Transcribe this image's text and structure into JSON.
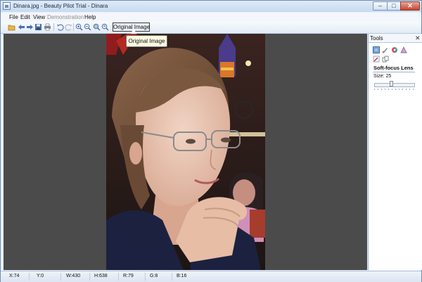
{
  "window": {
    "title": "Dinara.jpg - Beauty Pilot Trial - Dinara",
    "controls": {
      "minimize": "–",
      "maximize": "□",
      "close": "✕"
    }
  },
  "menubar": [
    {
      "label": "File",
      "enabled": true
    },
    {
      "label": "Edit",
      "enabled": true
    },
    {
      "label": "View",
      "enabled": true
    },
    {
      "label": "Demonstration",
      "enabled": false
    },
    {
      "label": "Help",
      "enabled": true
    }
  ],
  "toolbar": {
    "icons": [
      "open-icon",
      "back-icon",
      "forward-icon",
      "save-icon",
      "print-icon",
      "undo-icon",
      "redo-icon",
      "zoom-in-icon",
      "zoom-out-icon",
      "zoom-actual-icon",
      "zoom-fit-icon"
    ],
    "original_image_label": "Original Image",
    "tooltip": "Original Image"
  },
  "tools_panel": {
    "title": "Tools",
    "close": "✕",
    "tools": [
      "soft-focus-lens-icon",
      "brush-icon",
      "color-wheel-icon",
      "triangle-adjust-icon",
      "wand-icon",
      "copy-icon"
    ],
    "selected_tool": "Soft-focus Lens",
    "size_label": "Size: 25",
    "size_value": 25
  },
  "statusbar": {
    "x": "X:74",
    "y": "Y:0",
    "w": "W:430",
    "h": "H:638",
    "r": "R:79",
    "g": "G:8",
    "b": "B:16"
  },
  "colors": {
    "canvas_background": "#4b4b4b",
    "close_button": "#c8442c",
    "accent": "#2f5f9e"
  }
}
